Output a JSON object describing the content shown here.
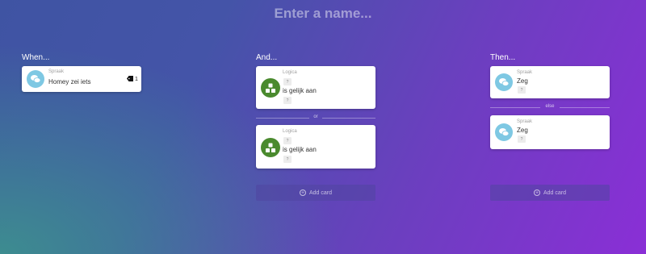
{
  "header": {
    "name_placeholder": "Enter a name...",
    "name_value": ""
  },
  "when": {
    "heading": "When...",
    "card": {
      "app": "Spraak",
      "text": "Homey zei iets",
      "tag_count": "1",
      "icon": "speech-bubbles-icon"
    }
  },
  "and": {
    "heading": "And...",
    "cards": [
      {
        "app": "Logica",
        "arg1": "?",
        "text": "is gelijk aan",
        "arg2": "?",
        "icon": "logic-blocks-icon"
      },
      {
        "app": "Logica",
        "arg1": "?",
        "text": "is gelijk aan",
        "arg2": "?",
        "icon": "logic-blocks-icon"
      }
    ],
    "separator": "or",
    "add_label": "Add card"
  },
  "then": {
    "heading": "Then...",
    "cards": [
      {
        "app": "Spraak",
        "text": "Zeg",
        "arg": "?",
        "icon": "speech-bubbles-icon"
      },
      {
        "app": "Spraak",
        "text": "Zeg",
        "arg": "?",
        "icon": "speech-bubbles-icon"
      }
    ],
    "separator": "else",
    "add_label": "Add card"
  },
  "colors": {
    "speech_badge": "#7ec8e3",
    "logic_badge": "#4a8a2e",
    "bg_start": "#3f54a3",
    "bg_end": "#8a2fd6"
  }
}
